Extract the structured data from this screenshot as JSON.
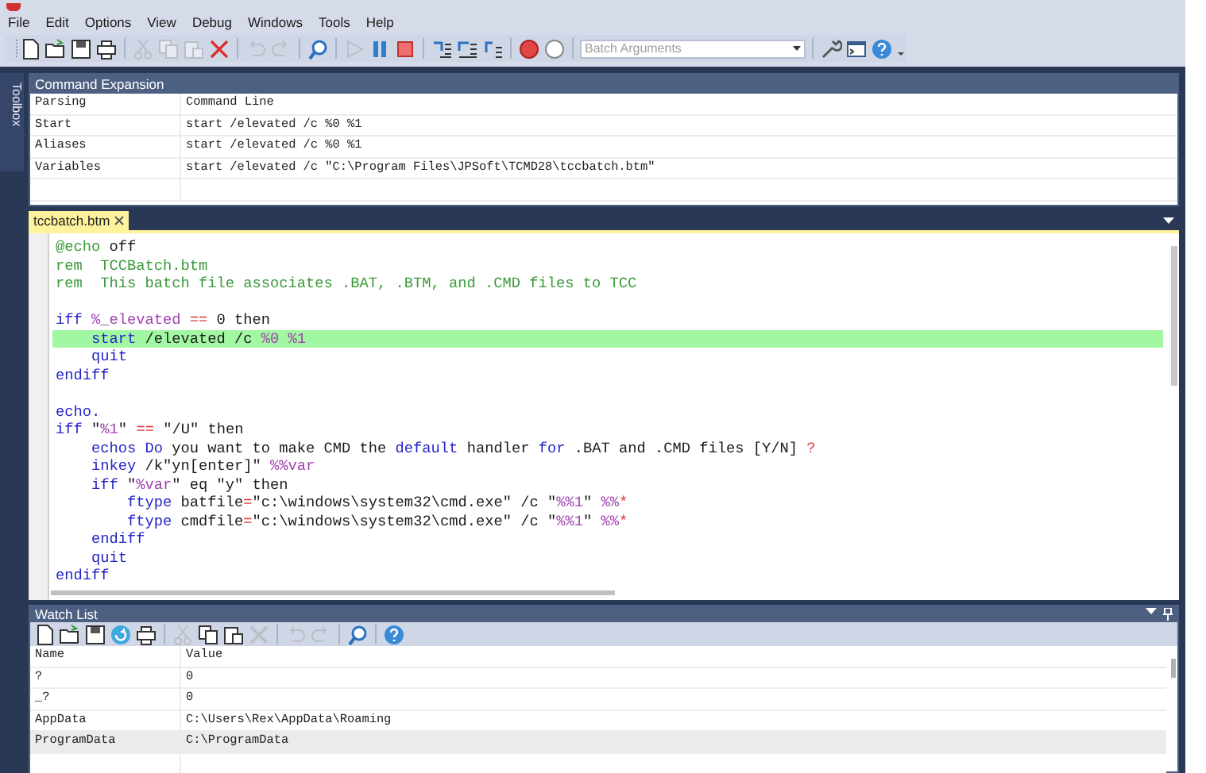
{
  "menu": [
    "File",
    "Edit",
    "Options",
    "View",
    "Debug",
    "Windows",
    "Tools",
    "Help"
  ],
  "toolbar": [
    {
      "kind": "new",
      "disabled": false
    },
    {
      "kind": "open",
      "disabled": false
    },
    {
      "kind": "save",
      "disabled": false
    },
    {
      "kind": "print",
      "disabled": false
    },
    {
      "kind": "separator"
    },
    {
      "kind": "cut",
      "disabled": true
    },
    {
      "kind": "copy",
      "disabled": true
    },
    {
      "kind": "paste",
      "disabled": true
    },
    {
      "kind": "delete",
      "disabled": false
    },
    {
      "kind": "separator"
    },
    {
      "kind": "undo",
      "disabled": true
    },
    {
      "kind": "redo",
      "disabled": true
    },
    {
      "kind": "separator"
    },
    {
      "kind": "find",
      "disabled": false
    },
    {
      "kind": "separator"
    },
    {
      "kind": "run",
      "disabled": true
    },
    {
      "kind": "pause",
      "disabled": false
    },
    {
      "kind": "stop",
      "disabled": false
    },
    {
      "kind": "separator"
    },
    {
      "kind": "step_into",
      "disabled": false
    },
    {
      "kind": "step_over",
      "disabled": false
    },
    {
      "kind": "step_out",
      "disabled": false
    },
    {
      "kind": "separator"
    },
    {
      "kind": "breakpoint",
      "disabled": false
    },
    {
      "kind": "clear",
      "disabled": false
    },
    {
      "kind": "separator"
    },
    {
      "kind": "combo",
      "placeholder": "Batch Arguments"
    },
    {
      "kind": "separator"
    },
    {
      "kind": "wrench",
      "disabled": false
    },
    {
      "kind": "console",
      "disabled": false
    },
    {
      "kind": "help",
      "disabled": false
    },
    {
      "kind": "more"
    }
  ],
  "toolbox": {
    "label": "Toolbox"
  },
  "command_expansion": {
    "title": "Command Expansion",
    "columns": [
      "Parsing",
      "Command Line"
    ],
    "rows": [
      {
        "cells": [
          "Start",
          "start /elevated /c %0 %1"
        ],
        "selected": false
      },
      {
        "cells": [
          "Aliases",
          "start /elevated /c %0 %1"
        ],
        "selected": false
      },
      {
        "cells": [
          "Variables",
          "start /elevated /c \"C:\\Program Files\\JPSoft\\TCMD28\\tccbatch.btm\""
        ],
        "selected": false
      }
    ]
  },
  "editor": {
    "tabs": [
      {
        "label": "tccbatch.btm",
        "selected": true
      }
    ],
    "lines": [
      {
        "kind": "code",
        "highlighted": false,
        "tokens": [
          {
            "text": "@echo",
            "kind": "comment"
          },
          {
            "text": " off",
            "kind": "plain"
          }
        ]
      },
      {
        "kind": "code",
        "highlighted": false,
        "tokens": [
          {
            "text": "rem  TCCBatch.btm",
            "kind": "comment"
          }
        ]
      },
      {
        "kind": "code",
        "highlighted": false,
        "tokens": [
          {
            "text": "rem  This batch file associates .BAT, .BTM, and .CMD files to TCC",
            "kind": "comment"
          }
        ]
      },
      {
        "kind": "blank"
      },
      {
        "kind": "code",
        "highlighted": false,
        "tokens": [
          {
            "text": "iff",
            "kind": "keyword"
          },
          {
            "text": " %_elevated",
            "kind": "variable"
          },
          {
            "text": " ==",
            "kind": "operator"
          },
          {
            "text": " 0 then",
            "kind": "plain"
          }
        ]
      },
      {
        "kind": "code",
        "highlighted": true,
        "tokens": [
          {
            "text": "    start",
            "kind": "keyword"
          },
          {
            "text": " /elevated /c ",
            "kind": "plain"
          },
          {
            "text": "%0",
            "kind": "variable"
          },
          {
            "text": " %1",
            "kind": "variable"
          }
        ]
      },
      {
        "kind": "code",
        "highlighted": false,
        "tokens": [
          {
            "text": "    quit",
            "kind": "keyword"
          }
        ]
      },
      {
        "kind": "code",
        "highlighted": false,
        "tokens": [
          {
            "text": "endiff",
            "kind": "keyword"
          }
        ]
      },
      {
        "kind": "blank"
      },
      {
        "kind": "code",
        "highlighted": false,
        "tokens": [
          {
            "text": "echo.",
            "kind": "keyword"
          }
        ]
      },
      {
        "kind": "code",
        "highlighted": false,
        "tokens": [
          {
            "text": "iff",
            "kind": "keyword"
          },
          {
            "text": " \"",
            "kind": "plain"
          },
          {
            "text": "%1",
            "kind": "variable"
          },
          {
            "text": "\" ",
            "kind": "plain"
          },
          {
            "text": "==",
            "kind": "operator"
          },
          {
            "text": " \"/U\" then",
            "kind": "plain"
          }
        ]
      },
      {
        "kind": "code",
        "highlighted": false,
        "tokens": [
          {
            "text": "    echos Do",
            "kind": "keyword"
          },
          {
            "text": " you want to make CMD the ",
            "kind": "plain"
          },
          {
            "text": "default",
            "kind": "keyword"
          },
          {
            "text": " handler ",
            "kind": "plain"
          },
          {
            "text": "for",
            "kind": "keyword"
          },
          {
            "text": " .BAT and .CMD files [Y/N] ",
            "kind": "plain"
          },
          {
            "text": "?",
            "kind": "operator"
          }
        ]
      },
      {
        "kind": "code",
        "highlighted": false,
        "tokens": [
          {
            "text": "    inkey",
            "kind": "keyword"
          },
          {
            "text": " /k\"yn[enter]\" ",
            "kind": "plain"
          },
          {
            "text": "%%var",
            "kind": "variable"
          }
        ]
      },
      {
        "kind": "code",
        "highlighted": false,
        "tokens": [
          {
            "text": "    iff",
            "kind": "keyword"
          },
          {
            "text": " \"",
            "kind": "plain"
          },
          {
            "text": "%var",
            "kind": "variable"
          },
          {
            "text": "\" eq \"y\" then",
            "kind": "plain"
          }
        ]
      },
      {
        "kind": "code",
        "highlighted": false,
        "tokens": [
          {
            "text": "        ftype",
            "kind": "keyword"
          },
          {
            "text": " batfile",
            "kind": "plain"
          },
          {
            "text": "=",
            "kind": "operator"
          },
          {
            "text": "\"c:\\windows\\system32\\cmd.exe\" /c \"",
            "kind": "plain"
          },
          {
            "text": "%%1",
            "kind": "variable"
          },
          {
            "text": "\" ",
            "kind": "plain"
          },
          {
            "text": "%%",
            "kind": "variable"
          },
          {
            "text": "*",
            "kind": "operator"
          }
        ]
      },
      {
        "kind": "code",
        "highlighted": false,
        "tokens": [
          {
            "text": "        ftype",
            "kind": "keyword"
          },
          {
            "text": " cmdfile",
            "kind": "plain"
          },
          {
            "text": "=",
            "kind": "operator"
          },
          {
            "text": "\"c:\\windows\\system32\\cmd.exe\" /c \"",
            "kind": "plain"
          },
          {
            "text": "%%1",
            "kind": "variable"
          },
          {
            "text": "\" ",
            "kind": "plain"
          },
          {
            "text": "%%",
            "kind": "variable"
          },
          {
            "text": "*",
            "kind": "operator"
          }
        ]
      },
      {
        "kind": "code",
        "highlighted": false,
        "tokens": [
          {
            "text": "    endiff",
            "kind": "keyword"
          }
        ]
      },
      {
        "kind": "code",
        "highlighted": false,
        "tokens": [
          {
            "text": "    quit",
            "kind": "keyword"
          }
        ]
      },
      {
        "kind": "code",
        "highlighted": false,
        "tokens": [
          {
            "text": "endiff",
            "kind": "keyword"
          }
        ]
      }
    ]
  },
  "watch_list": {
    "title": "Watch List",
    "toolbar": [
      {
        "kind": "new",
        "disabled": false
      },
      {
        "kind": "open",
        "disabled": false
      },
      {
        "kind": "save",
        "disabled": false
      },
      {
        "kind": "refresh",
        "disabled": false
      },
      {
        "kind": "print",
        "disabled": false
      },
      {
        "kind": "separator"
      },
      {
        "kind": "cut",
        "disabled": true
      },
      {
        "kind": "copy",
        "disabled": false
      },
      {
        "kind": "paste",
        "disabled": false
      },
      {
        "kind": "delete",
        "disabled": true
      },
      {
        "kind": "separator"
      },
      {
        "kind": "undo",
        "disabled": true
      },
      {
        "kind": "redo",
        "disabled": true
      },
      {
        "kind": "separator"
      },
      {
        "kind": "find",
        "disabled": false
      },
      {
        "kind": "separator"
      },
      {
        "kind": "help",
        "disabled": false
      }
    ],
    "columns": [
      "Name",
      "Value"
    ],
    "rows": [
      {
        "cells": [
          "?",
          "0"
        ],
        "selected": false
      },
      {
        "cells": [
          "_?",
          "0"
        ],
        "selected": false
      },
      {
        "cells": [
          "AppData",
          "C:\\Users\\Rex\\AppData\\Roaming"
        ],
        "selected": false
      },
      {
        "cells": [
          "ProgramData",
          "C:\\ProgramData"
        ],
        "selected": true
      }
    ]
  }
}
